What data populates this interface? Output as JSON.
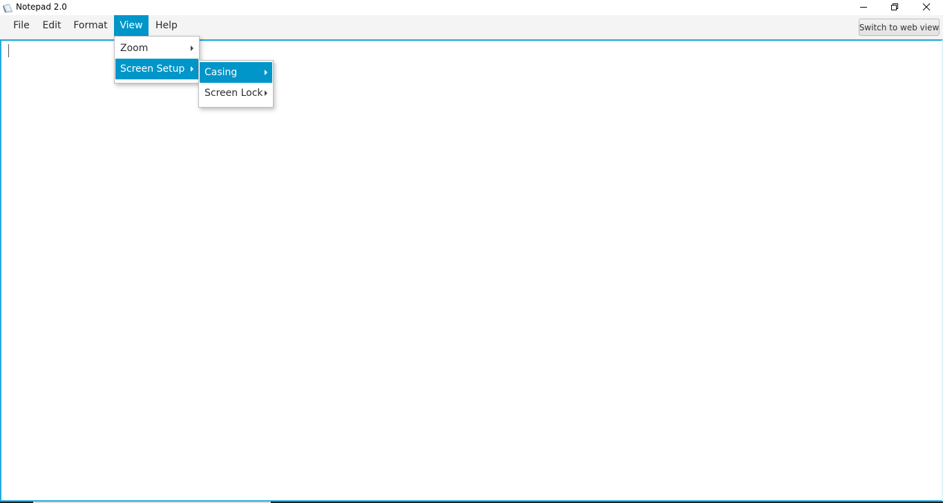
{
  "window": {
    "title": "Notepad 2.0",
    "icon": "notepad-app-icon",
    "controls": {
      "minimize_icon": "minimize-icon",
      "maximize_icon": "restore-icon",
      "close_icon": "close-icon"
    }
  },
  "menubar": {
    "items": [
      {
        "label": "File",
        "active": false
      },
      {
        "label": "Edit",
        "active": false
      },
      {
        "label": "Format",
        "active": false
      },
      {
        "label": "View",
        "active": true
      },
      {
        "label": "Help",
        "active": false
      }
    ],
    "switch_button_label": "Switch to web view"
  },
  "view_menu": {
    "items": [
      {
        "label": "Zoom",
        "has_submenu": true,
        "active": false
      },
      {
        "label": "Screen Setup",
        "has_submenu": true,
        "active": true
      }
    ]
  },
  "screen_setup_menu": {
    "items": [
      {
        "label": "Casing",
        "has_submenu": true,
        "active": true
      },
      {
        "label": "Screen Lock",
        "has_submenu": true,
        "active": false
      }
    ]
  },
  "editor": {
    "content": ""
  },
  "colors": {
    "accent": "#0096c9",
    "editor_border": "#26a9e0",
    "menubar_bg": "#f4f4f4"
  }
}
